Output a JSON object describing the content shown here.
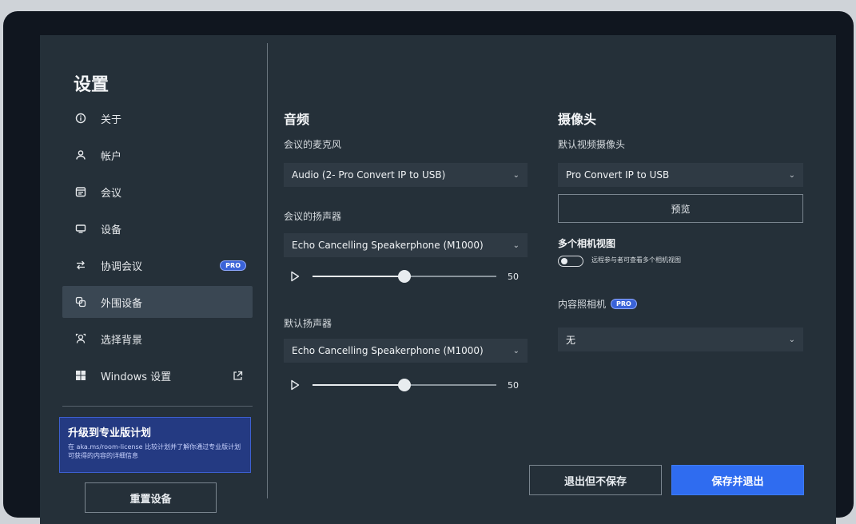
{
  "sidebar": {
    "title": "设置",
    "items": [
      {
        "label": "关于",
        "icon": "info-icon"
      },
      {
        "label": "帐户",
        "icon": "account-icon"
      },
      {
        "label": "会议",
        "icon": "calendar-icon"
      },
      {
        "label": "设备",
        "icon": "monitor-icon"
      },
      {
        "label": "协调会议",
        "icon": "swap-icon",
        "badge": "PRO"
      },
      {
        "label": "外围设备",
        "icon": "peripheral-icon",
        "active": true
      },
      {
        "label": "选择背景",
        "icon": "background-icon"
      },
      {
        "label": "Windows 设置",
        "icon": "windows-icon",
        "trailing_icon": "external-link-icon"
      }
    ],
    "promo": {
      "title": "升级到专业版计划",
      "text": "在 aka.ms/room-license 比较计划并了解你通过专业版计划可获得的内容的详细信息"
    },
    "reset_button": "重置设备"
  },
  "audio": {
    "title": "音频",
    "mic_label": "会议的麦克风",
    "mic_value": "Audio (2- Pro Convert IP to USB)",
    "speaker_label": "会议的扬声器",
    "speaker_value": "Echo Cancelling Speakerphone (M1000)",
    "speaker_volume": "50",
    "default_speaker_label": "默认扬声器",
    "default_speaker_value": "Echo Cancelling Speakerphone (M1000)",
    "default_speaker_volume": "50"
  },
  "camera": {
    "title": "摄像头",
    "default_label": "默认视频摄像头",
    "default_value": "Pro Convert IP to USB",
    "preview_button": "预览",
    "multi_title": "多个相机视图",
    "multi_toggle_text": "远程参与者可查看多个相机视图",
    "content_label": "内容照相机",
    "content_badge": "PRO",
    "content_value": "无"
  },
  "footer": {
    "discard_button": "退出但不保存",
    "save_button": "保存并退出"
  },
  "colors": {
    "background": "#253039",
    "accent": "#2f6cf0",
    "promo": "#243a82"
  }
}
